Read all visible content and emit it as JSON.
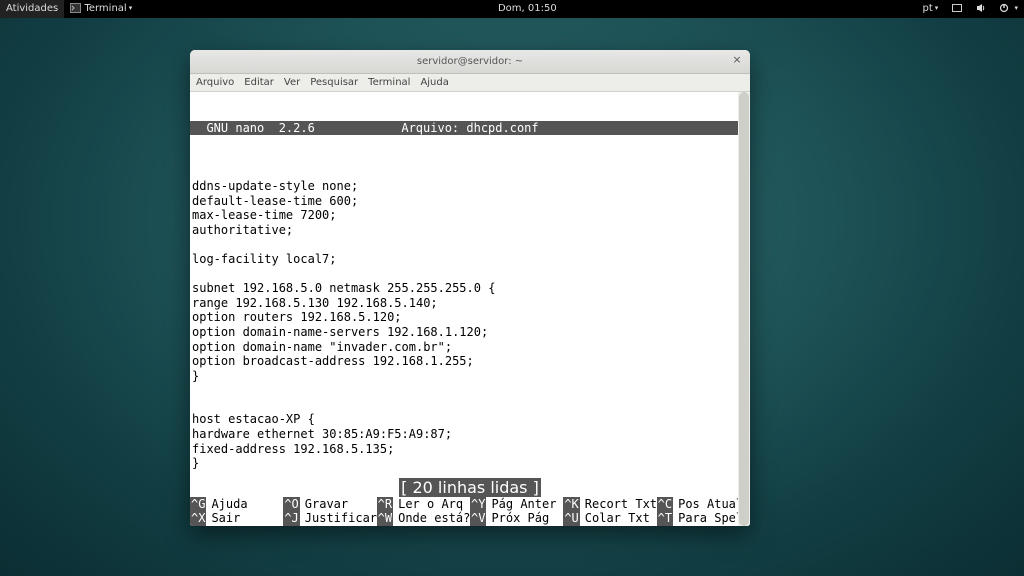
{
  "topbar": {
    "activities": "Atividades",
    "app_name": "Terminal",
    "clock": "Dom, 01:50",
    "lang": "pt"
  },
  "window": {
    "title": "servidor@servidor: ~",
    "menus": [
      "Arquivo",
      "Editar",
      "Ver",
      "Pesquisar",
      "Terminal",
      "Ajuda"
    ]
  },
  "nano": {
    "app": "GNU nano",
    "version": "2.2.6",
    "file_label": "Arquivo:",
    "filename": "dhcpd.conf",
    "content_lines": [
      "",
      "ddns-update-style none;",
      "default-lease-time 600;",
      "max-lease-time 7200;",
      "authoritative;",
      "",
      "log-facility local7;",
      "",
      "subnet 192.168.5.0 netmask 255.255.255.0 {",
      "range 192.168.5.130 192.168.5.140;",
      "option routers 192.168.5.120;",
      "option domain-name-servers 192.168.1.120;",
      "option domain-name \"invader.com.br\";",
      "option broadcast-address 192.168.1.255;",
      "}",
      "",
      "",
      "host estacao-XP {",
      "hardware ethernet 30:85:A9:F5:A9:87;",
      "fixed-address 192.168.5.135;",
      "}"
    ],
    "status": "[ 20 linhas lidas ]",
    "shortcuts_row1": [
      {
        "key": "^G",
        "label": "Ajuda"
      },
      {
        "key": "^O",
        "label": "Gravar"
      },
      {
        "key": "^R",
        "label": "Ler o Arq"
      },
      {
        "key": "^Y",
        "label": "Pág Anter"
      },
      {
        "key": "^K",
        "label": "Recort Txt"
      },
      {
        "key": "^C",
        "label": "Pos Atual"
      }
    ],
    "shortcuts_row2": [
      {
        "key": "^X",
        "label": "Sair"
      },
      {
        "key": "^J",
        "label": "Justificar"
      },
      {
        "key": "^W",
        "label": "Onde está?"
      },
      {
        "key": "^V",
        "label": "Próx Pág"
      },
      {
        "key": "^U",
        "label": "Colar Txt"
      },
      {
        "key": "^T",
        "label": "Para Spell"
      }
    ]
  }
}
